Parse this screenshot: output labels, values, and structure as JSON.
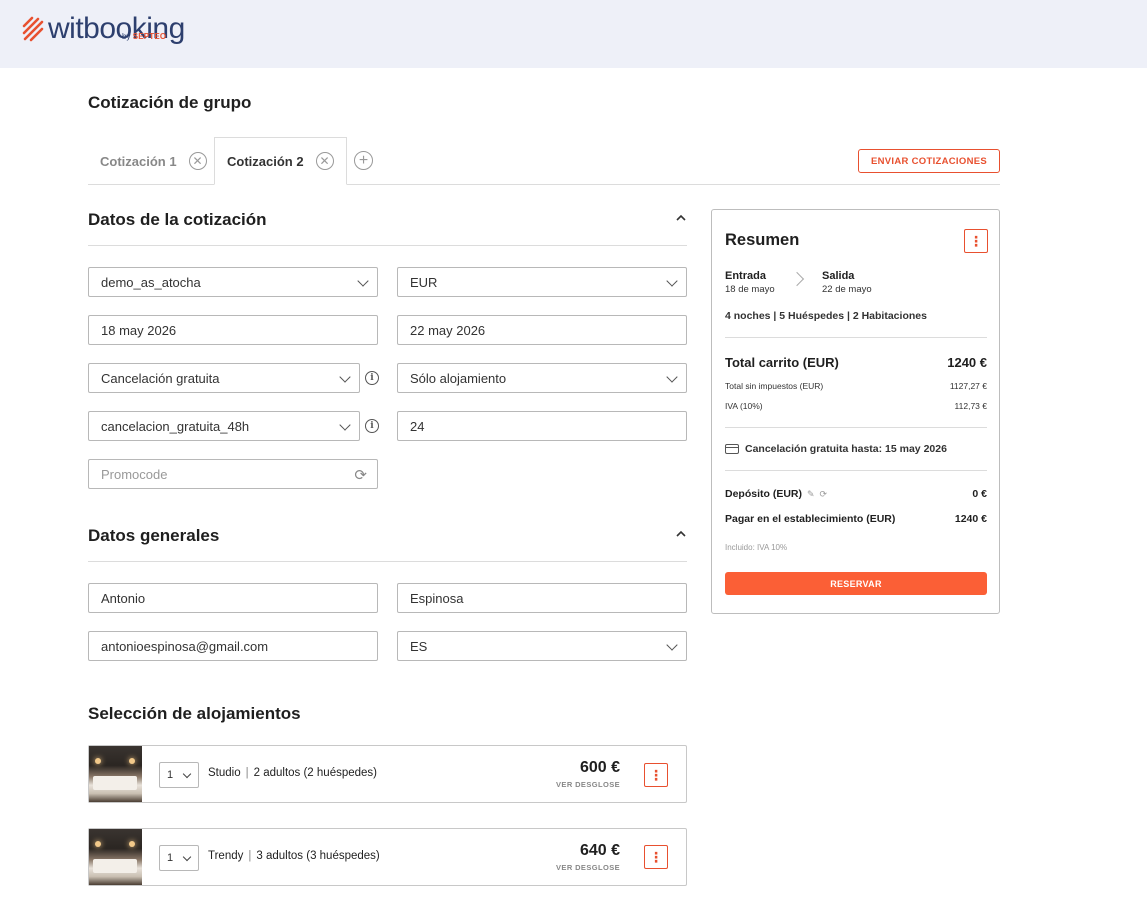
{
  "brand": {
    "name": "witbooking",
    "by": "by",
    "company": "SEPTEO",
    "accent": "#e8502f",
    "primary": "#fb5f36"
  },
  "page": {
    "title": "Cotización de grupo"
  },
  "tabs": [
    {
      "label": "Cotización 1",
      "active": false
    },
    {
      "label": "Cotización 2",
      "active": true
    }
  ],
  "actions": {
    "send_quotes": "ENVIAR COTIZACIONES"
  },
  "quote_section": {
    "title": "Datos de la cotización",
    "property": "demo_as_atocha",
    "currency": "EUR",
    "check_in": "18 may 2026",
    "check_out": "22 may 2026",
    "cancellation_policy": "Cancelación gratuita",
    "board": "Sólo alojamiento",
    "cancellation_code": "cancelacion_gratuita_48h",
    "hours": "24",
    "promocode_placeholder": "Promocode"
  },
  "general_section": {
    "title": "Datos generales",
    "first_name": "Antonio",
    "last_name": "Espinosa",
    "email": "antonioespinosa@gmail.com",
    "country": "ES"
  },
  "rooms_section": {
    "title": "Selección de alojamientos",
    "rooms": [
      {
        "qty": "1",
        "name": "Studio",
        "occupancy": "2 adultos (2 huéspedes)",
        "price": "600 €",
        "link": "VER DESGLOSE"
      },
      {
        "qty": "1",
        "name": "Trendy",
        "occupancy": "3 adultos (3 huéspedes)",
        "price": "640 €",
        "link": "VER DESGLOSE"
      }
    ]
  },
  "summary": {
    "title": "Resumen",
    "check_in_label": "Entrada",
    "check_in_date": "18 de mayo",
    "check_out_label": "Salida",
    "check_out_date": "22 de mayo",
    "meta": "4 noches | 5 Huéspedes | 2 Habitaciones",
    "total_label": "Total carrito (EUR)",
    "total_value": "1240 €",
    "net_label": "Total sin impuestos (EUR)",
    "net_value": "1127,27 €",
    "vat_label": "IVA (10%)",
    "vat_value": "112,73 €",
    "cancellation": "Cancelación gratuita hasta: 15 may 2026",
    "deposit_label": "Depósito (EUR)",
    "deposit_value": "0 €",
    "pay_label": "Pagar en el establecimiento (EUR)",
    "pay_value": "1240 €",
    "included": "Incluido: IVA 10%",
    "book_button": "RESERVAR"
  }
}
